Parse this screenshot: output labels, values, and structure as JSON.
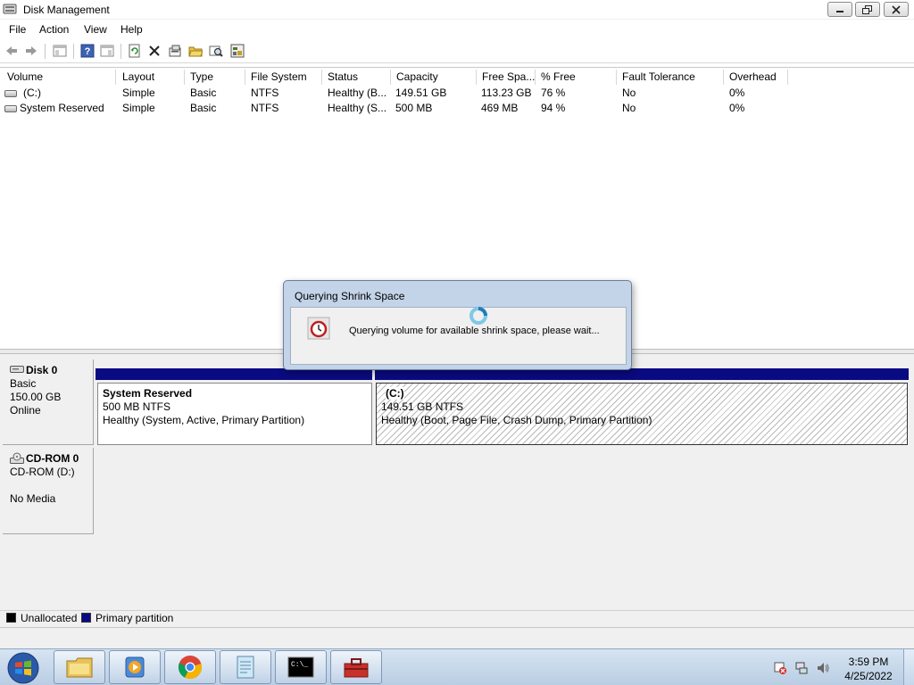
{
  "window": {
    "title": "Disk Management",
    "icon": "disk-management-icon"
  },
  "menu": [
    "File",
    "Action",
    "View",
    "Help"
  ],
  "toolbar": {
    "icons": [
      "back-icon",
      "forward-icon",
      "show-hide-console-tree-icon",
      "help-icon",
      "properties-icon",
      "refresh-icon",
      "delete-icon",
      "properties-icon-2",
      "open-icon",
      "explore-icon",
      "help-topic-icon"
    ]
  },
  "volume_list": {
    "columns": [
      "Volume",
      "Layout",
      "Type",
      "File System",
      "Status",
      "Capacity",
      "Free Spa...",
      "% Free",
      "Fault Tolerance",
      "Overhead"
    ],
    "rows": [
      [
        "(C:)",
        "Simple",
        "Basic",
        "NTFS",
        "Healthy (B...",
        "149.51 GB",
        "113.23 GB",
        "76 %",
        "No",
        "0%"
      ],
      [
        "System Reserved",
        "Simple",
        "Basic",
        "NTFS",
        "Healthy (S...",
        "500 MB",
        "469 MB",
        "94 %",
        "No",
        "0%"
      ]
    ]
  },
  "disks": [
    {
      "name": "Disk 0",
      "type": "Basic",
      "size": "150.00 GB",
      "status": "Online",
      "partitions": [
        {
          "name": "System Reserved",
          "size": "500 MB NTFS",
          "status": "Healthy (System, Active, Primary Partition)"
        },
        {
          "name": "(C:)",
          "size": "149.51 GB NTFS",
          "status": "Healthy (Boot, Page File, Crash Dump, Primary Partition)"
        }
      ]
    },
    {
      "name": "CD-ROM 0",
      "drive": "CD-ROM (D:)",
      "status": "No Media"
    }
  ],
  "legend": [
    {
      "label": "Unallocated",
      "color": "#000000"
    },
    {
      "label": "Primary partition",
      "color": "#0a0a82"
    }
  ],
  "dialog": {
    "title": "Querying Shrink Space",
    "message": "Querying volume for available shrink space, please wait..."
  },
  "taskbar": {
    "apps": [
      "windows-explorer-icon",
      "windows-media-player-icon",
      "chrome-icon",
      "notepad-icon",
      "command-prompt-icon",
      "toolbox-icon"
    ],
    "clock": {
      "time": "3:59 PM",
      "date": "4/25/2022"
    }
  }
}
